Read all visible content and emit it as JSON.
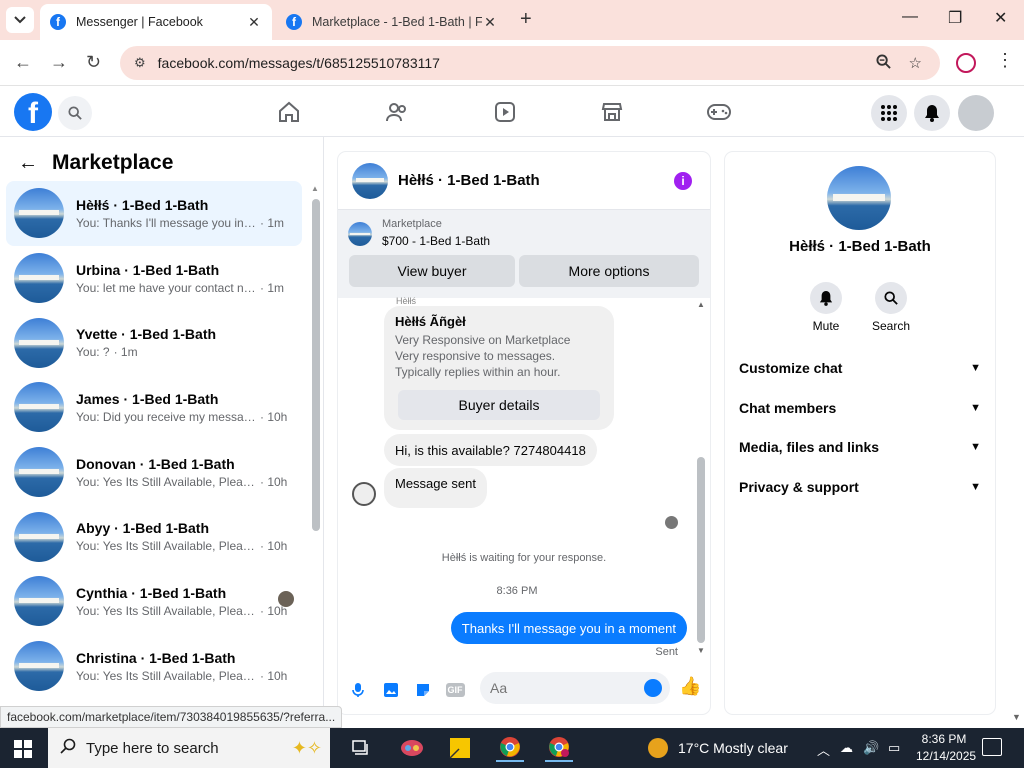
{
  "browser": {
    "tabs": [
      {
        "title": "Messenger | Facebook",
        "active": true
      },
      {
        "title": "Marketplace - 1-Bed 1-Bath | Fa",
        "active": false
      }
    ],
    "url": "facebook.com/messages/t/685125510783117",
    "status_url": "facebook.com/marketplace/item/730384019855635/?referra..."
  },
  "fb_header": {
    "logo_letter": "f"
  },
  "left_pane": {
    "title": "Marketplace",
    "conversations": [
      {
        "name": "Hèłłś · 1-Bed 1-Bath",
        "snippet": "You: Thanks I'll message you in a ...",
        "time": "· 1m",
        "selected": true
      },
      {
        "name": "Urbina · 1-Bed 1-Bath",
        "snippet": "You: let me have your contact nu...",
        "time": "· 1m"
      },
      {
        "name": "Yvette · 1-Bed 1-Bath",
        "snippet": "You: ?",
        "time": "· 1m"
      },
      {
        "name": "James · 1-Bed 1-Bath",
        "snippet": "You: Did you receive my message",
        "time": "· 10h"
      },
      {
        "name": "Donovan · 1-Bed 1-Bath",
        "snippet": "You: Yes Its Still Available, Please S...",
        "time": "· 10h"
      },
      {
        "name": "Abyy · 1-Bed 1-Bath",
        "snippet": "You: Yes Its Still Available, Please S...",
        "time": "· 10h"
      },
      {
        "name": "Cynthia · 1-Bed 1-Bath",
        "snippet": "You: Yes Its Still Available, Pleas...",
        "time": "· 10h"
      },
      {
        "name": "Christina · 1-Bed 1-Bath",
        "snippet": "You: Yes Its Still Available, Please S...",
        "time": "· 10h"
      }
    ]
  },
  "chat": {
    "title": "Hèłłś · 1-Bed 1-Bath",
    "marketplace_kicker": "Marketplace",
    "listing": "$700 - 1-Bed 1-Bath",
    "view_buyer": "View buyer",
    "more_options": "More options",
    "sender_tiny": "Hèłłś",
    "card": {
      "name": "Hèłłś Ãñgèł",
      "line1": "Very Responsive on Marketplace",
      "line2": "Very responsive to messages. Typically replies within an hour.",
      "button": "Buyer details"
    },
    "incoming": [
      "Hi, is this available? 7274804418",
      "Message sent"
    ],
    "waiting": "Hèłłś is waiting for your response.",
    "timestamp": "8:36 PM",
    "outgoing": "Thanks I'll message you in a moment",
    "sent_label": "Sent",
    "composer_placeholder": "Aa",
    "gif_label": "GIF"
  },
  "right_pane": {
    "name": "Hèłłś · 1-Bed 1-Bath",
    "actions": [
      {
        "label": "Mute",
        "icon": "bell-icon"
      },
      {
        "label": "Search",
        "icon": "search-icon"
      }
    ],
    "sections": [
      "Customize chat",
      "Chat members",
      "Media, files and links",
      "Privacy & support"
    ]
  },
  "taskbar": {
    "search_placeholder": "Type here to search",
    "weather": "17°C  Mostly clear",
    "time": "8:36 PM",
    "date": "12/14/2025"
  },
  "colors": {
    "fb_blue": "#1877f2",
    "messenger_blue": "#0a7cff",
    "tabbar": "#fae1dc",
    "selected_row": "#ebf5ff"
  }
}
